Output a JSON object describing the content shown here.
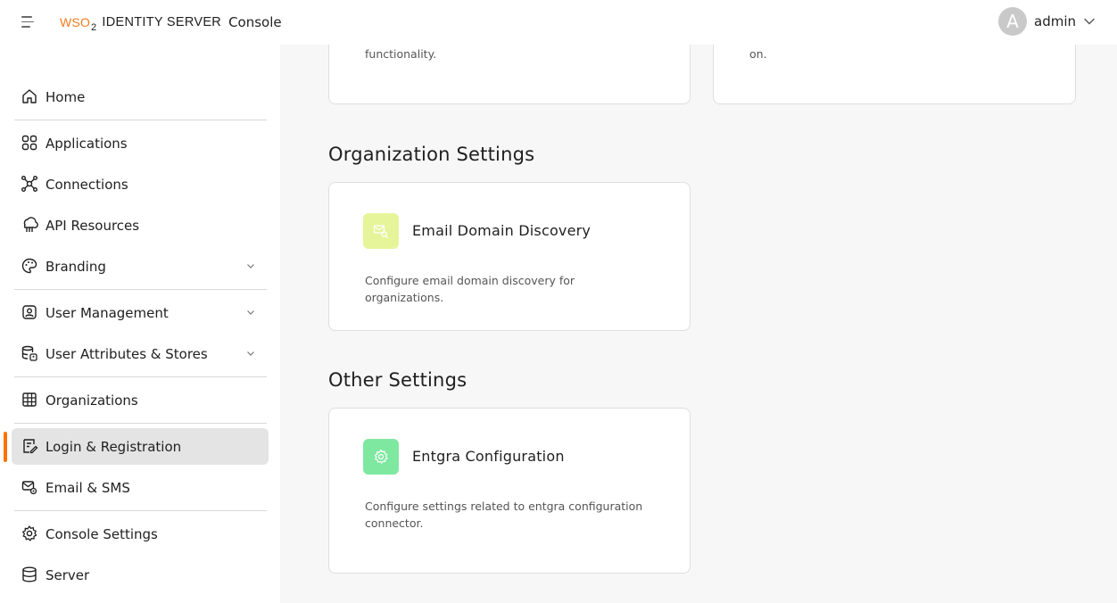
{
  "header": {
    "logo_text": "WSO",
    "logo_sub": "2",
    "product": "IDENTITY SERVER",
    "console": "Console",
    "avatar_initial": "A",
    "username": "admin"
  },
  "sidebar": {
    "items": [
      {
        "label": "Home",
        "icon": "home-icon"
      },
      {
        "label": "Applications",
        "icon": "applications-icon"
      },
      {
        "label": "Connections",
        "icon": "connections-icon"
      },
      {
        "label": "API Resources",
        "icon": "api-resources-icon"
      },
      {
        "label": "Branding",
        "icon": "palette-icon",
        "expandable": true
      },
      {
        "label": "User Management",
        "icon": "user-management-icon",
        "expandable": true
      },
      {
        "label": "User Attributes & Stores",
        "icon": "user-attributes-icon",
        "expandable": true
      },
      {
        "label": "Organizations",
        "icon": "organizations-icon"
      },
      {
        "label": "Login & Registration",
        "icon": "login-registration-icon",
        "active": true
      },
      {
        "label": "Email & SMS",
        "icon": "email-sms-icon"
      },
      {
        "label": "Console Settings",
        "icon": "gear-icon"
      },
      {
        "label": "Server",
        "icon": "server-icon"
      }
    ]
  },
  "main": {
    "partial_cards": [
      {
        "text": "functionality."
      },
      {
        "text": "on."
      }
    ],
    "sections": [
      {
        "title": "Organization Settings",
        "card": {
          "title": "Email Domain Discovery",
          "description": "Configure email domain discovery for organizations.",
          "icon": "email-search-icon",
          "icon_bg": "#e6f59a"
        }
      },
      {
        "title": "Other Settings",
        "card": {
          "title": "Entgra Configuration",
          "description": "Configure settings related to entgra configuration connector.",
          "icon": "settings-icon",
          "icon_bg": "#7ee8a0"
        }
      }
    ]
  },
  "colors": {
    "accent": "#ff7300",
    "brand": "#f47b20",
    "active_bg": "#e4e4e4"
  }
}
